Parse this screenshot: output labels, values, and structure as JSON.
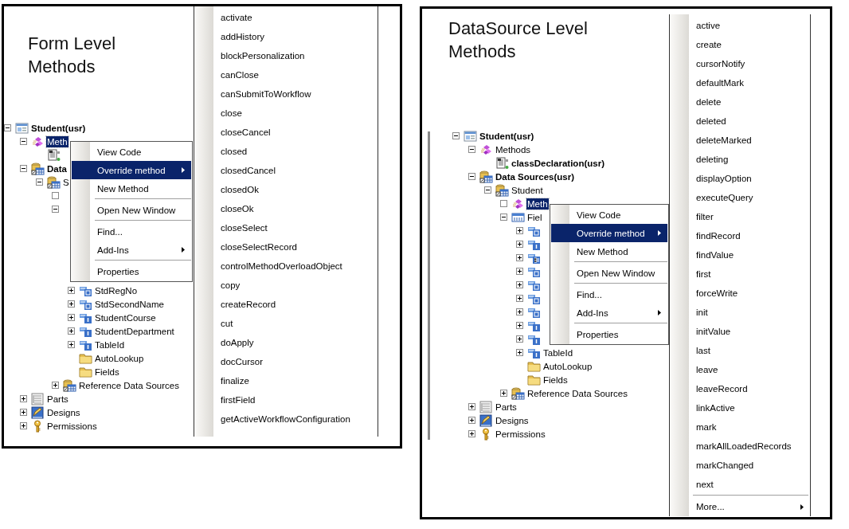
{
  "panels": [
    {
      "title": "Form Level Methods",
      "tree": [
        {
          "label": "Student(usr)",
          "bold": true,
          "kind": "form",
          "expanded": true,
          "selected": false,
          "children": [
            {
              "label": "Meth",
              "bold": false,
              "kind": "methods",
              "expanded": true,
              "selected": true,
              "children": [
                {
                  "kind": "class"
                }
              ]
            },
            {
              "label": "Data",
              "bold": true,
              "kind": "datasource",
              "expanded": true,
              "selected": false,
              "children": [
                {
                  "label": "S",
                  "bold": false,
                  "kind": "datasource",
                  "expanded": true,
                  "selected": false,
                  "children": [
                    {
                      "expanded": false,
                      "empty": true
                    },
                    {
                      "expanded": true,
                      "children": [
                        {
                          "label": "StdRegNo",
                          "bold": false,
                          "kind": "field-text",
                          "expanded": false,
                          "selected": false
                        },
                        {
                          "label": "StdSecondName",
                          "bold": false,
                          "kind": "field-text",
                          "expanded": false,
                          "selected": false
                        },
                        {
                          "label": "StudentCourse",
                          "bold": false,
                          "kind": "field-number",
                          "expanded": false,
                          "selected": false
                        },
                        {
                          "label": "StudentDepartment",
                          "bold": false,
                          "kind": "field-number",
                          "expanded": false,
                          "selected": false
                        },
                        {
                          "label": "TableId",
                          "bold": false,
                          "kind": "field-number",
                          "expanded": false,
                          "selected": false
                        },
                        {
                          "label": "AutoLookup",
                          "bold": false,
                          "kind": "folder",
                          "selected": false
                        },
                        {
                          "label": "Fields",
                          "bold": false,
                          "kind": "folder",
                          "selected": false
                        }
                      ]
                    },
                    {
                      "label": "Reference Data Sources",
                      "bold": false,
                      "kind": "datasource",
                      "expanded": false,
                      "selected": false
                    }
                  ]
                }
              ]
            },
            {
              "label": "Parts",
              "bold": false,
              "kind": "parts",
              "expanded": false,
              "selected": false
            },
            {
              "label": "Designs",
              "bold": false,
              "kind": "designs",
              "expanded": false,
              "selected": false
            },
            {
              "label": "Permissions",
              "bold": false,
              "kind": "permissions",
              "expanded": false,
              "selected": false
            }
          ]
        }
      ],
      "context_menu": [
        {
          "label": "View Code",
          "selected": false,
          "submenu": false,
          "separator_before": false
        },
        {
          "label": "Override method",
          "selected": true,
          "submenu": true,
          "separator_before": false
        },
        {
          "label": "New Method",
          "selected": false,
          "submenu": false,
          "separator_before": false
        },
        {
          "label": "Open New Window",
          "selected": false,
          "submenu": false,
          "separator_before": true
        },
        {
          "label": "Find...",
          "selected": false,
          "submenu": false,
          "separator_before": true
        },
        {
          "label": "Add-Ins",
          "selected": false,
          "submenu": true,
          "separator_before": false
        },
        {
          "label": "Properties",
          "selected": false,
          "submenu": false,
          "separator_before": true
        }
      ],
      "method_list": {
        "items": [
          "activate",
          "addHistory",
          "blockPersonalization",
          "canClose",
          "canSubmitToWorkflow",
          "close",
          "closeCancel",
          "closed",
          "closedCancel",
          "closedOk",
          "closeOk",
          "closeSelect",
          "closeSelectRecord",
          "controlMethodOverloadObject",
          "copy",
          "createRecord",
          "cut",
          "doApply",
          "docCursor",
          "finalize",
          "firstField",
          "getActiveWorkflowConfiguration"
        ]
      }
    },
    {
      "title": "DataSource Level Methods",
      "tree": [
        {
          "label": "Student(usr)",
          "bold": true,
          "kind": "form",
          "expanded": true,
          "selected": false,
          "children": [
            {
              "label": "Methods",
              "bold": false,
              "kind": "methods",
              "expanded": true,
              "selected": false,
              "children": [
                {
                  "label": "classDeclaration(usr)",
                  "bold": true,
                  "kind": "class",
                  "selected": false
                }
              ]
            },
            {
              "label": "Data Sources(usr)",
              "bold": true,
              "kind": "datasource",
              "expanded": true,
              "selected": false,
              "children": [
                {
                  "label": "Student",
                  "bold": false,
                  "kind": "datasource",
                  "expanded": true,
                  "selected": false,
                  "children": [
                    {
                      "label": "Meth",
                      "bold": false,
                      "kind": "methods",
                      "expanded": false,
                      "empty": true,
                      "selected": true
                    },
                    {
                      "label": "Fiel",
                      "bold": false,
                      "kind": "fields",
                      "expanded": true,
                      "selected": false,
                      "children": [
                        {
                          "kind": "field-text",
                          "expanded": false
                        },
                        {
                          "kind": "field-number",
                          "expanded": false
                        },
                        {
                          "kind": "field-date",
                          "expanded": false
                        },
                        {
                          "kind": "field-text",
                          "expanded": false
                        },
                        {
                          "kind": "field-text",
                          "expanded": false
                        },
                        {
                          "kind": "field-text",
                          "expanded": false
                        },
                        {
                          "kind": "field-text",
                          "expanded": false
                        },
                        {
                          "kind": "field-number",
                          "expanded": false
                        },
                        {
                          "kind": "field-number",
                          "expanded": false
                        },
                        {
                          "label": "TableId",
                          "bold": false,
                          "kind": "field-number",
                          "expanded": false,
                          "selected": false
                        },
                        {
                          "label": "AutoLookup",
                          "bold": false,
                          "kind": "folder",
                          "selected": false
                        },
                        {
                          "label": "Fields",
                          "bold": false,
                          "kind": "folder",
                          "selected": false
                        }
                      ]
                    },
                    {
                      "label": "Reference Data Sources",
                      "bold": false,
                      "kind": "datasource",
                      "expanded": false,
                      "selected": false
                    }
                  ]
                }
              ]
            },
            {
              "label": "Parts",
              "bold": false,
              "kind": "parts",
              "expanded": false,
              "selected": false
            },
            {
              "label": "Designs",
              "bold": false,
              "kind": "designs",
              "expanded": false,
              "selected": false
            },
            {
              "label": "Permissions",
              "bold": false,
              "kind": "permissions",
              "expanded": false,
              "selected": false
            }
          ]
        }
      ],
      "context_menu": [
        {
          "label": "View Code",
          "selected": false,
          "submenu": false,
          "separator_before": false
        },
        {
          "label": "Override method",
          "selected": true,
          "submenu": true,
          "separator_before": false
        },
        {
          "label": "New Method",
          "selected": false,
          "submenu": false,
          "separator_before": false
        },
        {
          "label": "Open New Window",
          "selected": false,
          "submenu": false,
          "separator_before": true
        },
        {
          "label": "Find...",
          "selected": false,
          "submenu": false,
          "separator_before": true
        },
        {
          "label": "Add-Ins",
          "selected": false,
          "submenu": true,
          "separator_before": false
        },
        {
          "label": "Properties",
          "selected": false,
          "submenu": false,
          "separator_before": true
        }
      ],
      "method_list": {
        "items": [
          "active",
          "create",
          "cursorNotify",
          "defaultMark",
          "delete",
          "deleted",
          "deleteMarked",
          "deleting",
          "displayOption",
          "executeQuery",
          "filter",
          "findRecord",
          "findValue",
          "first",
          "forceWrite",
          "init",
          "initValue",
          "last",
          "leave",
          "leaveRecord",
          "linkActive",
          "mark",
          "markAllLoadedRecords",
          "markChanged",
          "next"
        ],
        "footer": {
          "label": "More...",
          "submenu": true
        }
      }
    }
  ]
}
